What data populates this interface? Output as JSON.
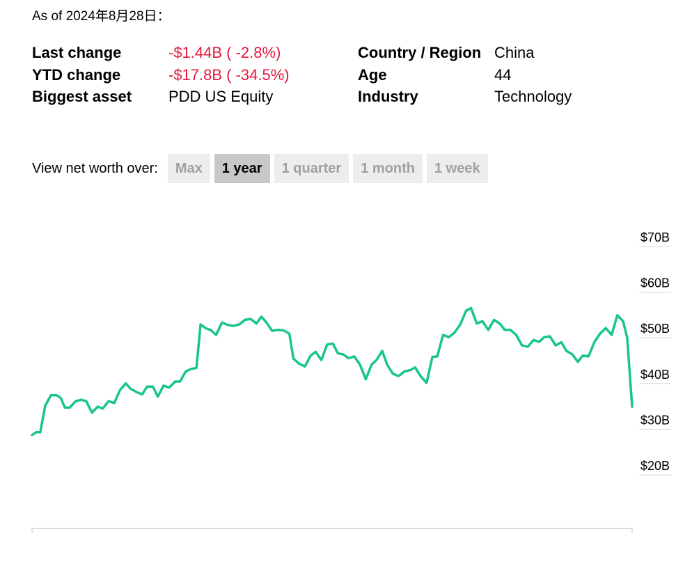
{
  "header": {
    "as_of": "As of 2024年8月28日："
  },
  "stats": {
    "last_change_label": "Last change",
    "last_change_value": "-$1.44B ( -2.8%)",
    "ytd_change_label": "YTD change",
    "ytd_change_value": "-$17.8B ( -34.5%)",
    "biggest_asset_label": "Biggest asset",
    "biggest_asset_value": "PDD US Equity",
    "country_label": "Country / Region",
    "country_value": "China",
    "age_label": "Age",
    "age_value": "44",
    "industry_label": "Industry",
    "industry_value": "Technology"
  },
  "range_selector": {
    "label": "View net worth over:",
    "options": [
      "Max",
      "1 year",
      "1 quarter",
      "1 month",
      "1 week"
    ],
    "selected": "1 year"
  },
  "colors": {
    "line": "#19c588",
    "negative": "#e4193d"
  },
  "chart_data": {
    "type": "line",
    "title": "",
    "xlabel": "",
    "ylabel": "",
    "ylim": [
      12,
      75
    ],
    "y_ticks": [
      70,
      60,
      50,
      40,
      30,
      20
    ],
    "y_tick_labels": [
      "$70B",
      "$60B",
      "$50B",
      "$40B",
      "$30B",
      "$20B"
    ],
    "grid": false,
    "series": [
      {
        "values": [
          26.6,
          27.2,
          27.2,
          33.0,
          35.3,
          35.3,
          34.7,
          32.6,
          32.6,
          34.0,
          34.3,
          34.0,
          31.5,
          32.8,
          32.4,
          34.0,
          33.6,
          36.4,
          37.9,
          36.7,
          36.0,
          35.5,
          37.2,
          37.2,
          35.0,
          37.4,
          37.0,
          38.3,
          38.3,
          40.5,
          41.0,
          41.3,
          50.8,
          50.0,
          49.5,
          48.5,
          51.2,
          50.7,
          50.5,
          50.8,
          51.8,
          52.0,
          51.0,
          52.5,
          51.3,
          49.4,
          49.6,
          49.5,
          48.8,
          43.3,
          42.2,
          41.6,
          44.0,
          44.8,
          43.0,
          46.4,
          46.6,
          44.5,
          44.2,
          43.4,
          43.8,
          42.0,
          38.8,
          42.0,
          43.0,
          45.0,
          42.0,
          40.0,
          39.5,
          40.5,
          40.8,
          41.4,
          39.4,
          38.0,
          43.7,
          43.8,
          48.5,
          48.0,
          49.0,
          50.8,
          53.8,
          54.4,
          51.0,
          51.5,
          49.6,
          51.8,
          51.0,
          49.6,
          49.6,
          48.5,
          46.2,
          45.9,
          47.4,
          47.0,
          48.0,
          48.2,
          46.2,
          46.9,
          45.0,
          44.3,
          42.6,
          44.0,
          43.8,
          46.9,
          48.8,
          50.0,
          48.5,
          52.8,
          51.5,
          47.9,
          32.8
        ],
        "x": [
          0,
          0.5,
          1.0,
          1.6,
          2.3,
          3.0,
          3.5,
          4.0,
          4.6,
          5.3,
          6.0,
          6.6,
          7.3,
          8.0,
          8.6,
          9.3,
          10.0,
          10.7,
          11.4,
          12.0,
          12.7,
          13.4,
          14.0,
          14.7,
          15.3,
          16.0,
          16.7,
          17.4,
          18.0,
          18.7,
          19.3,
          20.0,
          20.5,
          21.1,
          21.8,
          22.4,
          23.1,
          23.8,
          24.5,
          25.2,
          25.9,
          26.6,
          27.3,
          27.9,
          28.5,
          29.2,
          29.9,
          30.6,
          31.3,
          31.8,
          32.5,
          33.2,
          33.9,
          34.5,
          35.2,
          35.9,
          36.6,
          37.2,
          37.9,
          38.5,
          39.2,
          39.9,
          40.6,
          41.3,
          41.9,
          42.6,
          43.2,
          43.9,
          44.6,
          45.3,
          46.0,
          46.6,
          47.3,
          48.0,
          48.7,
          49.3,
          50.0,
          50.7,
          51.4,
          52.1,
          52.8,
          53.4,
          54.1,
          54.8,
          55.5,
          56.2,
          56.9,
          57.5,
          58.2,
          58.9,
          59.6,
          60.3,
          61.0,
          61.7,
          62.3,
          63.0,
          63.7,
          64.4,
          65.0,
          65.7,
          66.4,
          67.0,
          67.7,
          68.4,
          69.1,
          69.8,
          70.5,
          71.2,
          71.9,
          72.4,
          73.0
        ]
      }
    ]
  }
}
